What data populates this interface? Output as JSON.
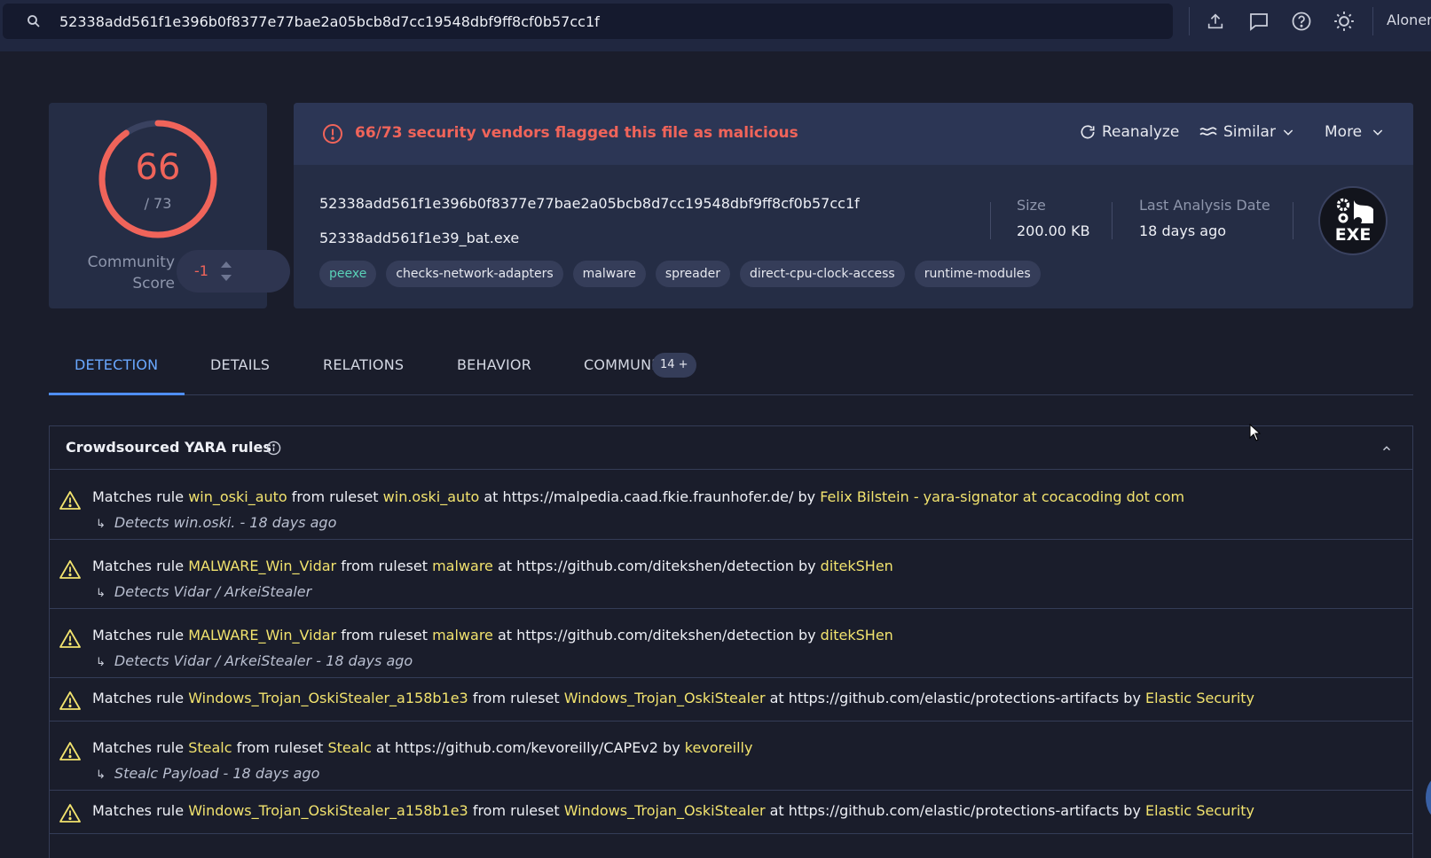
{
  "search": {
    "value": "52338add561f1e396b0f8377e77bae2a05bcb8d7cc19548dbf9ff8cf0b57cc1f"
  },
  "topbar": {
    "icons": [
      "upload-icon",
      "chat-icon",
      "help-icon",
      "theme-icon"
    ],
    "user": "Aloner"
  },
  "score": {
    "positives": "66",
    "total": "/ 73",
    "community_label_1": "Community",
    "community_label_2": "Score",
    "community_value": "-1",
    "positives_fraction": 0.904,
    "color": "#f0645a"
  },
  "alert": {
    "text": "66/73 security vendors flagged this file as malicious",
    "reanalyze": "Reanalyze",
    "similar": "Similar",
    "more": "More"
  },
  "file": {
    "hash": "52338add561f1e396b0f8377e77bae2a05bcb8d7cc19548dbf9ff8cf0b57cc1f",
    "name": "52338add561f1e39_bat.exe",
    "tags": [
      "peexe",
      "checks-network-adapters",
      "malware",
      "spreader",
      "direct-cpu-clock-access",
      "runtime-modules"
    ],
    "size_label": "Size",
    "size_value": "200.00 KB",
    "date_label": "Last Analysis Date",
    "date_value": "18 days ago",
    "type_badge": "EXE"
  },
  "tabs": {
    "detection": "DETECTION",
    "details": "DETAILS",
    "relations": "RELATIONS",
    "behavior": "BEHAVIOR",
    "community": "COMMUNITY",
    "community_count": "14 +"
  },
  "yara": {
    "title": "Crowdsourced YARA rules",
    "rows": [
      {
        "p1": "Matches rule ",
        "rule": "win_oski_auto",
        "p2": " from ruleset ",
        "ruleset": "win.oski_auto",
        "p3": " at https://malpedia.caad.fkie.fraunhofer.de/ by ",
        "author": "Felix Bilstein - yara-signator at cocacoding dot com",
        "sub": "Detects win.oski. - 18 days ago"
      },
      {
        "p1": "Matches rule ",
        "rule": "MALWARE_Win_Vidar",
        "p2": " from ruleset ",
        "ruleset": "malware",
        "p3": " at https://github.com/ditekshen/detection by ",
        "author": "ditekSHen",
        "sub": "Detects Vidar / ArkeiStealer"
      },
      {
        "p1": "Matches rule ",
        "rule": "MALWARE_Win_Vidar",
        "p2": " from ruleset ",
        "ruleset": "malware",
        "p3": " at https://github.com/ditekshen/detection by ",
        "author": "ditekSHen",
        "sub": "Detects Vidar / ArkeiStealer - 18 days ago"
      },
      {
        "p1": "Matches rule ",
        "rule": "Windows_Trojan_OskiStealer_a158b1e3",
        "p2": " from ruleset ",
        "ruleset": "Windows_Trojan_OskiStealer",
        "p3": " at https://github.com/elastic/protections-artifacts by ",
        "author": "Elastic Security",
        "sub": ""
      },
      {
        "p1": "Matches rule ",
        "rule": "Stealc",
        "p2": " from ruleset ",
        "ruleset": "Stealc",
        "p3": " at https://github.com/kevoreilly/CAPEv2 by ",
        "author": "kevoreilly",
        "sub": "Stealc Payload - 18 days ago"
      },
      {
        "p1": "Matches rule ",
        "rule": "Windows_Trojan_OskiStealer_a158b1e3",
        "p2": " from ruleset ",
        "ruleset": "Windows_Trojan_OskiStealer",
        "p3": " at https://github.com/elastic/protections-artifacts by ",
        "author": "Elastic Security",
        "sub": ""
      }
    ]
  },
  "colors": {
    "malicious": "#f0645a",
    "highlight": "#f2e36e",
    "accent": "#4f8ef7",
    "tag_peexe": "#5ad1b8"
  }
}
